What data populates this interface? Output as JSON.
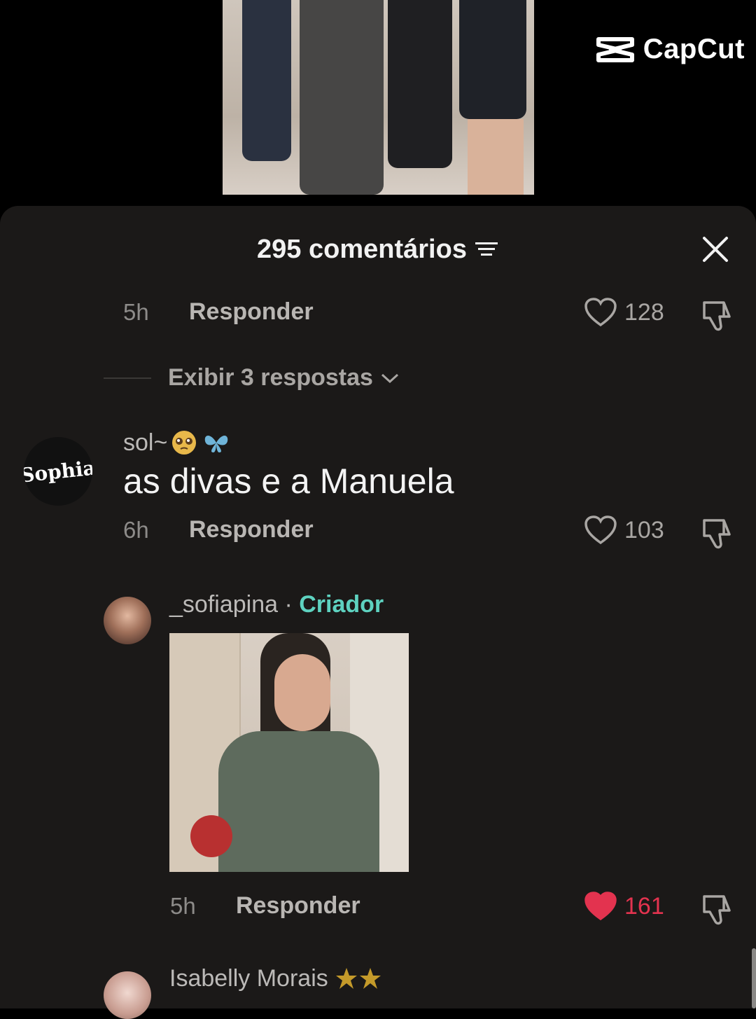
{
  "watermark": {
    "brand": "CapCut"
  },
  "header": {
    "title": "295 comentários"
  },
  "comments": [
    {
      "time": "5h",
      "reply_label": "Responder",
      "likes": "128",
      "liked": false
    },
    {
      "username": "sol~",
      "text": "as divas e a Manuela",
      "avatar_text": "Sophia",
      "time": "6h",
      "reply_label": "Responder",
      "likes": "103",
      "liked": false
    },
    {
      "username": "_sofiapina",
      "separator": " · ",
      "badge": "Criador",
      "time": "5h",
      "reply_label": "Responder",
      "likes": "161",
      "liked": true
    },
    {
      "username": "Isabelly Morais"
    }
  ],
  "view_replies": {
    "label": "Exibir 3 respostas"
  },
  "colors": {
    "sheet_bg": "#1b1918",
    "creator_accent": "#5ed2c0",
    "liked_red": "#e3334f"
  },
  "icons": [
    "capcut-logo-icon",
    "filter-icon",
    "close-icon",
    "heart-icon",
    "dislike-icon",
    "chevron-down-icon",
    "star-icon"
  ]
}
